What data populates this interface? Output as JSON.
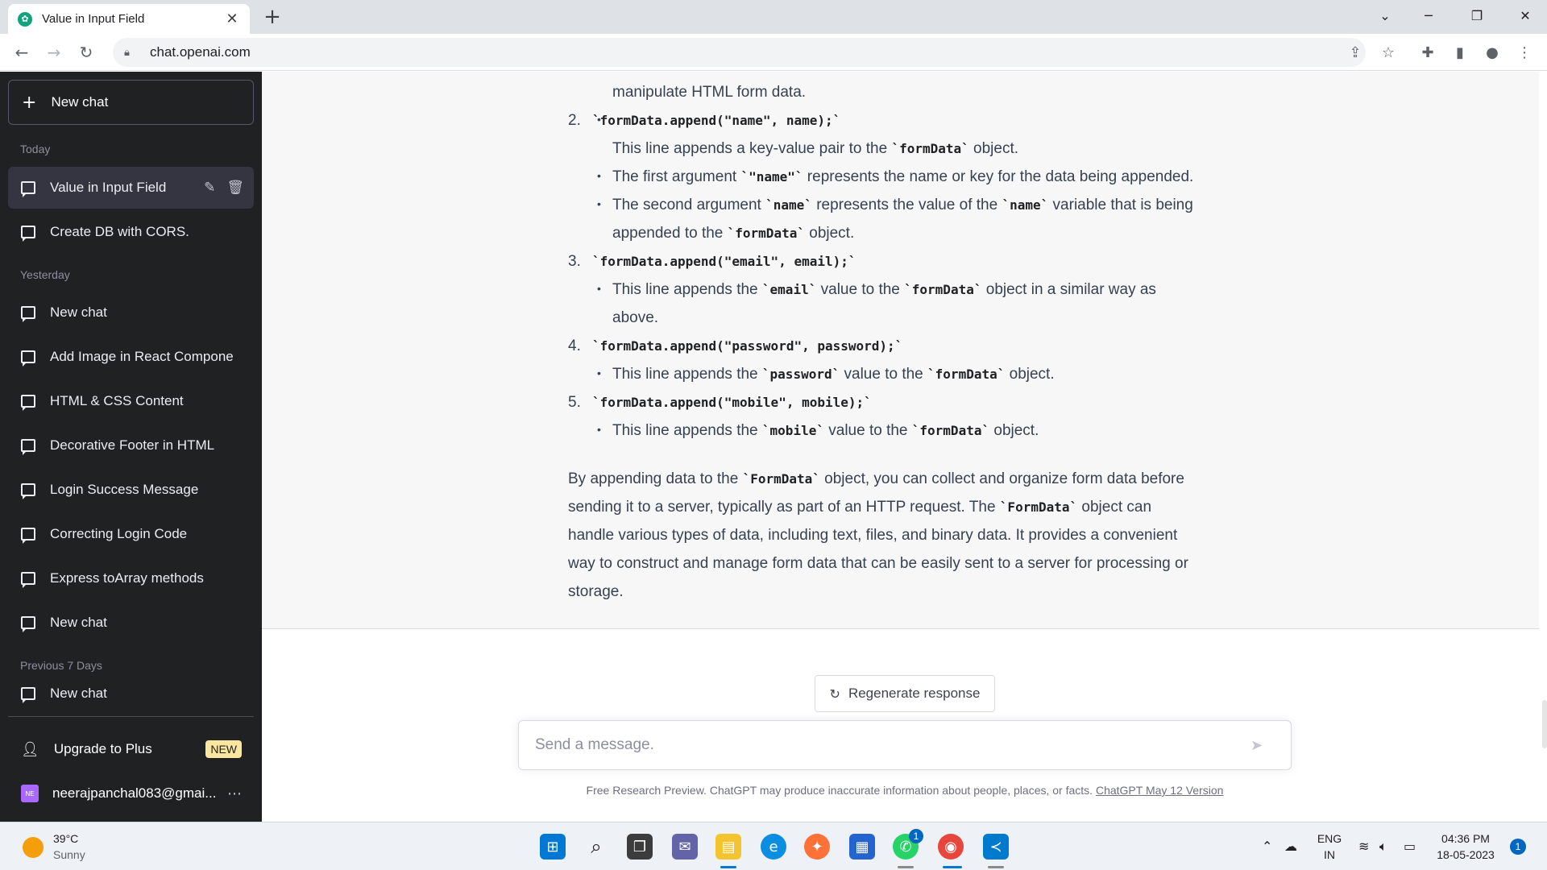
{
  "browser": {
    "tab_title": "Value in Input Field",
    "url": "chat.openai.com"
  },
  "sidebar": {
    "new_chat_label": "New chat",
    "sections": {
      "today": "Today",
      "yesterday": "Yesterday",
      "previous7": "Previous 7 Days"
    },
    "items": [
      {
        "label": "Value in Input Field",
        "active": true
      },
      {
        "label": "Create DB with CORS."
      },
      {
        "label": "New chat"
      },
      {
        "label": "Add Image in React Compone"
      },
      {
        "label": "HTML & CSS Content"
      },
      {
        "label": "Decorative Footer in HTML"
      },
      {
        "label": "Login Success Message"
      },
      {
        "label": "Correcting Login Code"
      },
      {
        "label": "Express toArray methods"
      },
      {
        "label": "New chat"
      },
      {
        "label": "New chat"
      }
    ],
    "upgrade_label": "Upgrade to Plus",
    "upgrade_badge": "NEW",
    "account_initials": "NE",
    "account_email": "neerajpanchal083@gmai..."
  },
  "answer": {
    "l0": "manipulate HTML form data.",
    "n2": "2.",
    "c2": "`formData.append(\"name\", name);`",
    "b2a_1": "This line appends a key-value pair to the ",
    "b2a_code": "`formData`",
    "b2a_2": " object.",
    "b2b_1": "The first argument ",
    "b2b_code": "`\"name\"`",
    "b2b_2": " represents the name or key for the data being appended.",
    "b2c_1": "The second argument ",
    "b2c_code1": "`name`",
    "b2c_2": " represents the value of the ",
    "b2c_code2": "`name`",
    "b2c_3": " variable that is being",
    "b2c_4": "appended to the ",
    "b2c_code3": "`formData`",
    "b2c_5": " object.",
    "n3": "3.",
    "c3": "`formData.append(\"email\", email);`",
    "b3_1": "This line appends the ",
    "b3_code1": "`email`",
    "b3_2": " value to the ",
    "b3_code2": "`formData`",
    "b3_3": " object in a similar way as",
    "b3_4": "above.",
    "n4": "4.",
    "c4": "`formData.append(\"password\", password);`",
    "b4_1": "This line appends the ",
    "b4_code1": "`password`",
    "b4_2": " value to the ",
    "b4_code2": "`formData`",
    "b4_3": " object.",
    "n5": "5.",
    "c5": "`formData.append(\"mobile\", mobile);`",
    "b5_1": "This line appends the ",
    "b5_code1": "`mobile`",
    "b5_2": " value to the ",
    "b5_code2": "`formData`",
    "b5_3": " object.",
    "p1_1": "By appending data to the ",
    "p1_code1": "`FormData`",
    "p1_2": " object, you can collect and organize form data before",
    "p2_1": "sending it to a server, typically as part of an HTTP request. The ",
    "p2_code1": "`FormData`",
    "p2_2": " object can",
    "p3": "handle various types of data, including text, files, and binary data. It provides a convenient",
    "p4": "way to construct and manage form data that can be easily sent to a server for processing or",
    "p5": "storage."
  },
  "composer": {
    "regenerate_label": "Regenerate response",
    "placeholder": "Send a message.",
    "footer_text": "Free Research Preview. ChatGPT may produce inaccurate information about people, places, or facts. ",
    "footer_link": "ChatGPT May 12 Version"
  },
  "taskbar": {
    "temperature": "39°C",
    "weather": "Sunny",
    "whatsapp_badge": "1",
    "lang_top": "ENG",
    "lang_bottom": "IN",
    "time": "04:36 PM",
    "date": "18-05-2023",
    "notification_count": "1"
  },
  "colors": {
    "sidebar_bg": "#202123",
    "answer_bg": "#f7f7f8",
    "accent": "#10a37f",
    "badge": "#fae69e"
  }
}
